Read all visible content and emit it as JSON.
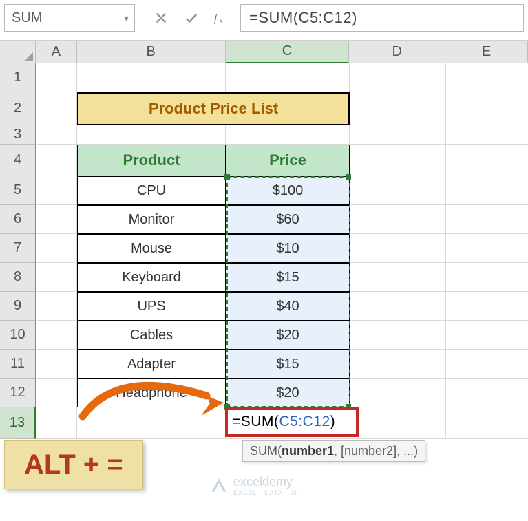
{
  "name_box": "SUM",
  "formula_bar": "=SUM(C5:C12)",
  "columns": [
    "A",
    "B",
    "C",
    "D",
    "E"
  ],
  "rows": [
    "1",
    "2",
    "3",
    "4",
    "5",
    "6",
    "7",
    "8",
    "9",
    "10",
    "11",
    "12",
    "13"
  ],
  "active_col": "C",
  "active_row": "13",
  "title_cell": "Product Price List",
  "headers": {
    "product": "Product",
    "price": "Price"
  },
  "table": [
    {
      "product": "CPU",
      "price": "$100"
    },
    {
      "product": "Monitor",
      "price": "$60"
    },
    {
      "product": "Mouse",
      "price": "$10"
    },
    {
      "product": "Keyboard",
      "price": "$15"
    },
    {
      "product": "UPS",
      "price": "$40"
    },
    {
      "product": "Cables",
      "price": "$20"
    },
    {
      "product": "Adapter",
      "price": "$15"
    },
    {
      "product": "Headphone",
      "price": "$20"
    }
  ],
  "editing": {
    "eq": "=",
    "fn": "SUM",
    "open": "(",
    "range": "C5:C12",
    "close": ")"
  },
  "tooltip": {
    "fn": "SUM",
    "sig1": "number1",
    "sig2": ", [number2], ...)"
  },
  "callout": "ALT + =",
  "watermark": {
    "brand": "exceldemy",
    "tag": "EXCEL · DATA · BI"
  },
  "chart_data": {
    "type": "table",
    "title": "Product Price List",
    "categories": [
      "CPU",
      "Monitor",
      "Mouse",
      "Keyboard",
      "UPS",
      "Cables",
      "Adapter",
      "Headphone"
    ],
    "values": [
      100,
      60,
      10,
      15,
      40,
      20,
      15,
      20
    ],
    "xlabel": "Product",
    "ylabel": "Price"
  }
}
